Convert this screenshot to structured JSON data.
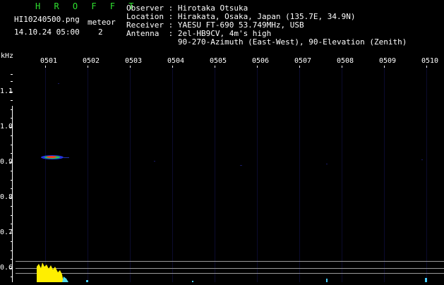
{
  "header": {
    "brand": "H R O F F T",
    "filename": "HI10240500.png",
    "datetime": "14.10.24 05:00",
    "meteor_label": "meteor",
    "meteor_count": "2",
    "observer": "Observer : Hirotaka Otsuka",
    "location": "Location : Hirakata, Osaka, Japan (135.7E, 34.9N)",
    "receiver": "Receiver : YAESU FT-690 53.749MHz, USB",
    "antenna": "Antenna  : 2el-HB9CV, 4m's high",
    "antenna2": "           90-270-Azimuth (East-West), 90-Elevation (Zenith)"
  },
  "axis": {
    "unit": "kHz",
    "y_ticks": [
      "1.1",
      "1.0",
      "0.9",
      "0.8",
      "0.7",
      "0.6"
    ],
    "x_ticks": [
      "0501",
      "0502",
      "0503",
      "0504",
      "0505",
      "0506",
      "0507",
      "0508",
      "0509",
      "0510"
    ]
  },
  "colors": {
    "text": "#ffffff",
    "brand": "#2fe02f",
    "background": "#000000",
    "noise_floor": "#ffee00"
  }
}
